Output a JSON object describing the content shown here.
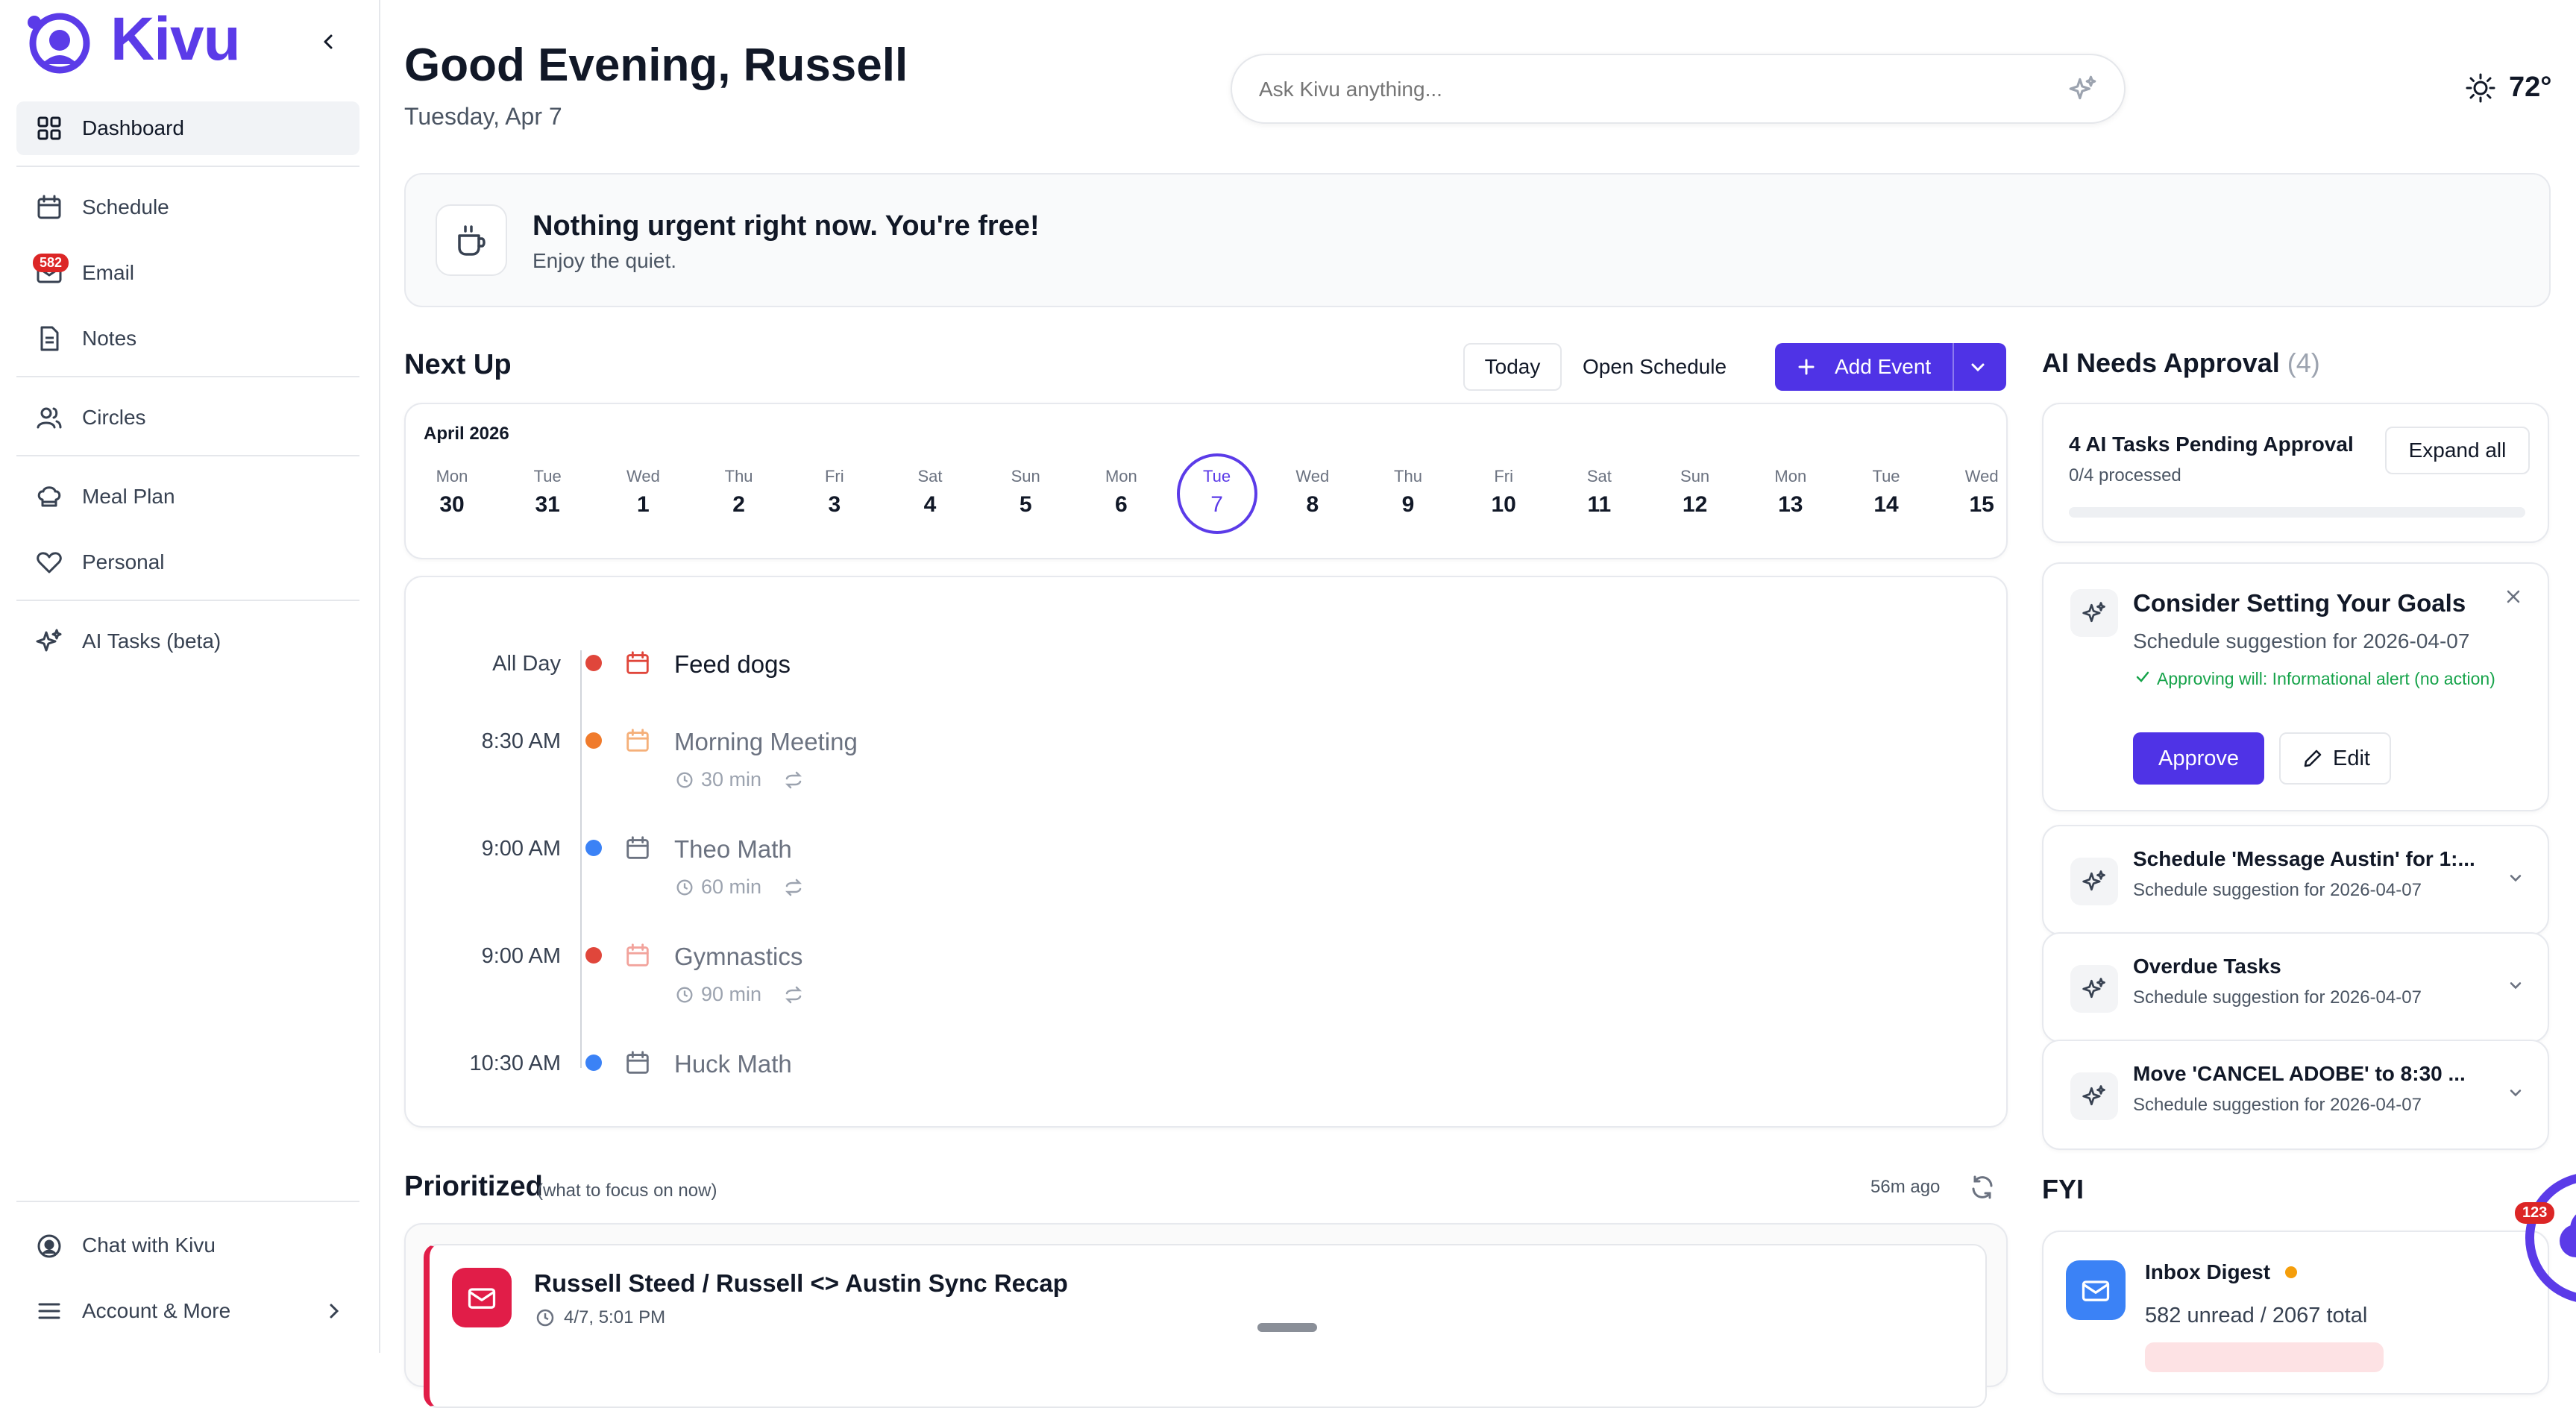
{
  "app": {
    "name": "Kivu",
    "brand_color": "#5b3be8"
  },
  "sidebar": {
    "items": [
      {
        "label": "Dashboard",
        "icon": "grid-icon",
        "active": true
      },
      {
        "label": "Schedule",
        "icon": "calendar-icon"
      },
      {
        "label": "Email",
        "icon": "mail-icon",
        "badge": "582"
      },
      {
        "label": "Notes",
        "icon": "document-icon"
      },
      {
        "label": "Circles",
        "icon": "users-icon"
      },
      {
        "label": "Meal Plan",
        "icon": "chef-hat-icon"
      },
      {
        "label": "Personal",
        "icon": "heart-icon"
      },
      {
        "label": "AI Tasks (beta)",
        "icon": "sparkles-icon"
      }
    ],
    "footer": {
      "chat": "Chat with Kivu",
      "account": "Account & More"
    }
  },
  "header": {
    "greeting": "Good Evening, Russell",
    "date": "Tuesday, Apr 7",
    "search_placeholder": "Ask Kivu anything...",
    "weather": "72°"
  },
  "banner": {
    "title": "Nothing urgent right now. You're free!",
    "subtitle": "Enjoy the quiet."
  },
  "next_up": {
    "title": "Next Up",
    "today_label": "Today",
    "open_schedule_label": "Open Schedule",
    "add_event_label": "Add Event",
    "month": "April 2026",
    "days": [
      {
        "dn": "Mon",
        "dd": "30"
      },
      {
        "dn": "Tue",
        "dd": "31"
      },
      {
        "dn": "Wed",
        "dd": "1"
      },
      {
        "dn": "Thu",
        "dd": "2"
      },
      {
        "dn": "Fri",
        "dd": "3"
      },
      {
        "dn": "Sat",
        "dd": "4"
      },
      {
        "dn": "Sun",
        "dd": "5"
      },
      {
        "dn": "Mon",
        "dd": "6"
      },
      {
        "dn": "Tue",
        "dd": "7",
        "selected": true
      },
      {
        "dn": "Wed",
        "dd": "8"
      },
      {
        "dn": "Thu",
        "dd": "9"
      },
      {
        "dn": "Fri",
        "dd": "10"
      },
      {
        "dn": "Sat",
        "dd": "11"
      },
      {
        "dn": "Sun",
        "dd": "12"
      },
      {
        "dn": "Mon",
        "dd": "13"
      },
      {
        "dn": "Tue",
        "dd": "14"
      },
      {
        "dn": "Wed",
        "dd": "15"
      }
    ],
    "events": [
      {
        "time": "All Day",
        "title": "Feed dogs",
        "dot": "#e0463b",
        "icon_color": "#e0463b",
        "duration": ""
      },
      {
        "time": "8:30 AM",
        "title": "Morning Meeting",
        "dot": "#f07b2c",
        "icon_color": "#f5b07a",
        "duration": "30 min"
      },
      {
        "time": "9:00 AM",
        "title": "Theo Math",
        "dot": "#3b82f6",
        "icon_color": "#6b7280",
        "duration": "60 min"
      },
      {
        "time": "9:00 AM",
        "title": "Gymnastics",
        "dot": "#e0463b",
        "icon_color": "#f2a39c",
        "duration": "90 min"
      },
      {
        "time": "10:30 AM",
        "title": "Huck Math",
        "dot": "#3b82f6",
        "icon_color": "#6b7280",
        "duration": ""
      }
    ]
  },
  "approval": {
    "title": "AI Needs Approval",
    "count": "(4)",
    "summary_title": "4 AI Tasks Pending Approval",
    "summary_sub": "0/4 processed",
    "progress": 0,
    "expand_label": "Expand all",
    "expanded": {
      "title": "Consider Setting Your Goals",
      "sub": "Schedule suggestion for 2026-04-07",
      "note": "Approving will: Informational alert (no action)",
      "approve_label": "Approve",
      "edit_label": "Edit"
    },
    "items": [
      {
        "title": "Schedule 'Message Austin' for 1:...",
        "sub": "Schedule suggestion for 2026-04-07"
      },
      {
        "title": "Overdue Tasks",
        "sub": "Schedule suggestion for 2026-04-07"
      },
      {
        "title": "Move 'CANCEL ADOBE' to 8:30 ...",
        "sub": "Schedule suggestion for 2026-04-07"
      }
    ]
  },
  "prioritized": {
    "title": "Prioritized",
    "subtitle": "(what to focus on now)",
    "updated": "56m ago",
    "items": [
      {
        "title": "Russell Steed / Russell <> Austin Sync Recap",
        "time": "4/7, 5:01 PM"
      }
    ]
  },
  "fyi": {
    "title": "FYI",
    "digest_title": "Inbox Digest",
    "digest_sub": "582 unread / 2067 total",
    "badge": "123"
  }
}
